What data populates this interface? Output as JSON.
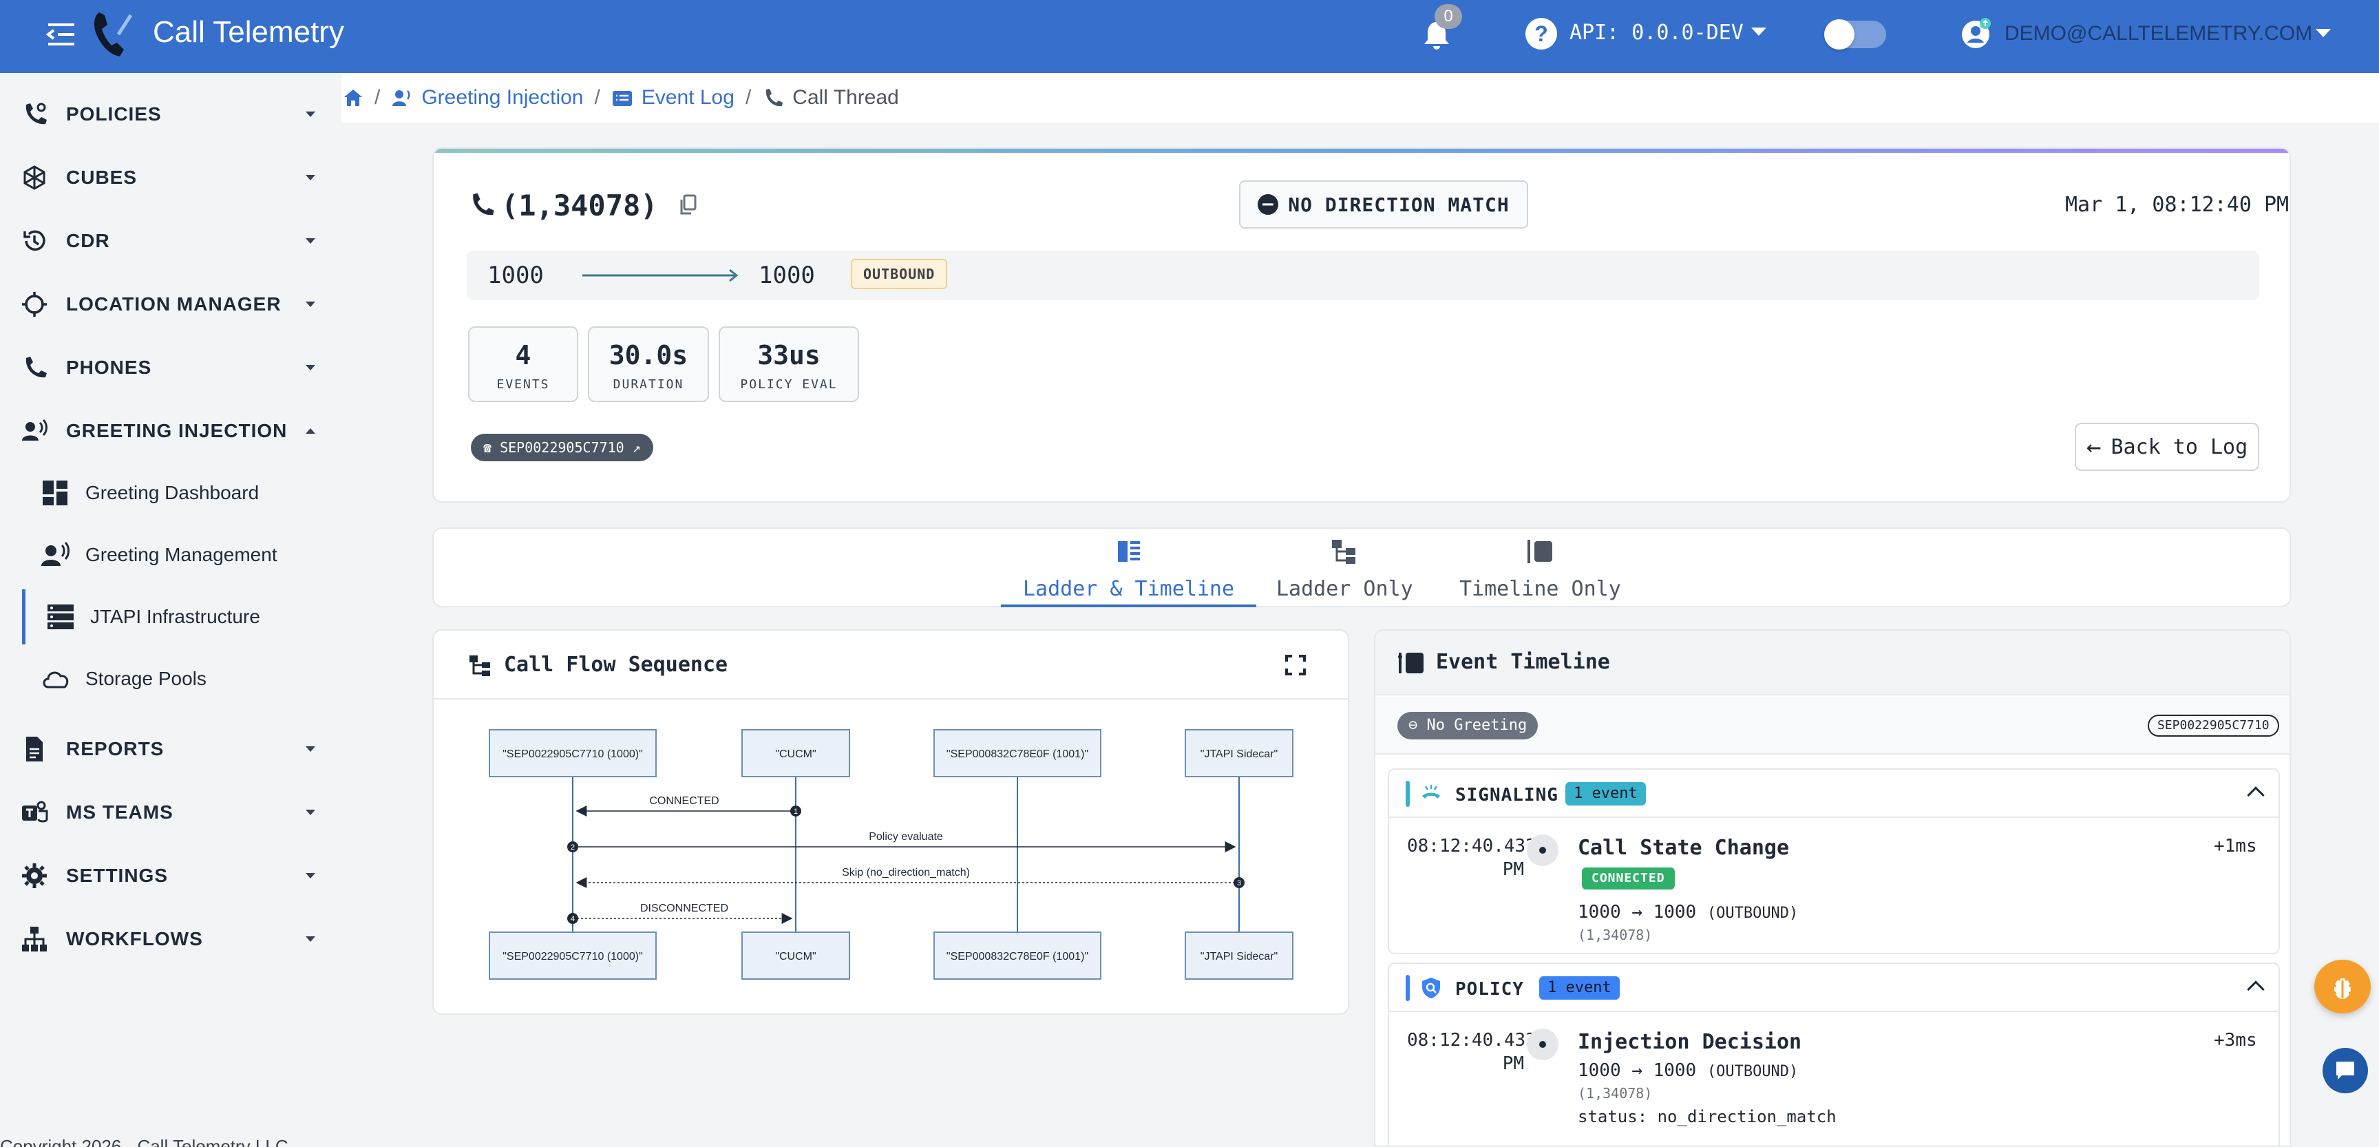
{
  "header": {
    "app_title": "Call Telemetry",
    "notification_count": "0",
    "api_label": "API: 0.0.0-DEV",
    "user_email": "DEMO@CALLTELEMETRY.COM",
    "help_glyph": "?"
  },
  "sidebar": {
    "items": [
      {
        "label": "POLICIES",
        "icon": "phone-gear-icon"
      },
      {
        "label": "CUBES",
        "icon": "cube-icon"
      },
      {
        "label": "CDR",
        "icon": "history-icon"
      },
      {
        "label": "LOCATION MANAGER",
        "icon": "crosshair-icon"
      },
      {
        "label": "PHONES",
        "icon": "phone-icon"
      },
      {
        "label": "GREETING INJECTION",
        "icon": "speaker-user-icon"
      },
      {
        "label": "REPORTS",
        "icon": "report-icon"
      },
      {
        "label": "MS TEAMS",
        "icon": "teams-icon"
      },
      {
        "label": "SETTINGS",
        "icon": "gear-icon"
      },
      {
        "label": "WORKFLOWS",
        "icon": "workflow-icon"
      }
    ],
    "sub_items": [
      {
        "label": "Greeting Dashboard",
        "icon": "dashboard-icon"
      },
      {
        "label": "Greeting Management",
        "icon": "speaker-user-icon"
      },
      {
        "label": "JTAPI Infrastructure",
        "icon": "server-icon"
      },
      {
        "label": "Storage Pools",
        "icon": "cloud-icon"
      }
    ],
    "copyright": "Copyright 2026 - Call Telemetry LLC"
  },
  "breadcrumb": {
    "items": [
      {
        "label": "Greeting Injection",
        "icon": "speaker-user-icon"
      },
      {
        "label": "Event Log",
        "icon": "list-icon"
      },
      {
        "label": "Call Thread",
        "icon": "phone-icon"
      }
    ]
  },
  "call": {
    "id": "(1,34078)",
    "direction_badge": "NO DIRECTION MATCH",
    "timestamp": "Mar 1, 08:12:40 PM",
    "from": "1000",
    "to": "1000",
    "direction": "OUTBOUND",
    "stats": [
      {
        "value": "4",
        "label": "EVENTS"
      },
      {
        "value": "30.0s",
        "label": "DURATION"
      },
      {
        "value": "33us",
        "label": "POLICY EVAL"
      }
    ],
    "device": "SEP0022905C7710",
    "back_label": "Back to Log"
  },
  "tabs": [
    {
      "label": "Ladder & Timeline",
      "active": true
    },
    {
      "label": "Ladder Only",
      "active": false
    },
    {
      "label": "Timeline Only",
      "active": false
    }
  ],
  "flow": {
    "title": "Call Flow Sequence",
    "participants": [
      "\"SEP0022905C7710 (1000)\"",
      "\"CUCM\"",
      "\"SEP000832C78E0F (1001)\"",
      "\"JTAPI Sidecar\""
    ],
    "messages": [
      {
        "from": 1,
        "to": 0,
        "label": "CONNECTED",
        "style": "solid",
        "num": "1"
      },
      {
        "from": 0,
        "to": 3,
        "label": "Policy evaluate",
        "style": "solid",
        "num": "2"
      },
      {
        "from": 3,
        "to": 0,
        "label": "Skip (no_direction_match)",
        "style": "dotted",
        "num": "3"
      },
      {
        "from": 0,
        "to": 1,
        "label": "DISCONNECTED",
        "style": "dotted",
        "num": "4"
      }
    ]
  },
  "timeline": {
    "title": "Event Timeline",
    "filter_label": "No Greeting",
    "device": "SEP0022905C7710",
    "groups": [
      {
        "name": "SIGNALING",
        "count": "1 event",
        "color": "#38b2cc",
        "event": {
          "time1": "08:12:40.432",
          "time2": "PM",
          "title": "Call State Change",
          "delta": "+1ms",
          "badge": "CONNECTED",
          "route": "1000 → 1000",
          "route_dir": "(OUTBOUND)",
          "call_id": "(1,34078)"
        }
      },
      {
        "name": "POLICY",
        "count": "1 event",
        "color": "#3b82f6",
        "event": {
          "time1": "08:12:40.433",
          "time2": "PM",
          "title": "Injection Decision",
          "delta": "+3ms",
          "route": "1000 → 1000",
          "route_dir": "(OUTBOUND)",
          "call_id": "(1,34078)",
          "status": "status: no_direction_match"
        }
      }
    ]
  }
}
